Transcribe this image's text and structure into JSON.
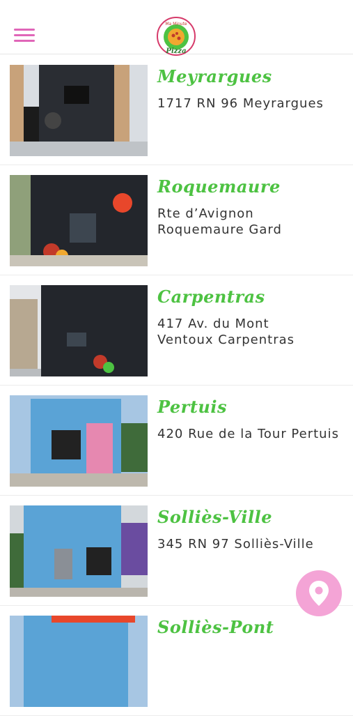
{
  "header": {
    "menu_icon": "hamburger-menu-icon",
    "logo_text": "Pizza",
    "logo_top_text": "Ma Minute"
  },
  "locations": [
    {
      "city": "Meyrargues",
      "address_lines": [
        "1717 RN 96 Meyrargues"
      ]
    },
    {
      "city": "Roquemaure",
      "address_lines": [
        "Rte d’Avignon",
        "Roquemaure Gard"
      ]
    },
    {
      "city": "Carpentras",
      "address_lines": [
        "417 Av. du Mont",
        "Ventoux Carpentras"
      ]
    },
    {
      "city": "Pertuis",
      "address_lines": [
        "420 Rue de la Tour Pertuis"
      ]
    },
    {
      "city": "Solliès-Ville",
      "address_lines": [
        "345 RN 97 Solliès-Ville"
      ]
    },
    {
      "city": "Solliès-Pont",
      "address_lines": []
    }
  ],
  "fab": {
    "icon": "map-pin-icon"
  },
  "colors": {
    "accent_green": "#4dc242",
    "accent_pink": "#e066b8",
    "fab_pink": "#f4a4d6"
  }
}
